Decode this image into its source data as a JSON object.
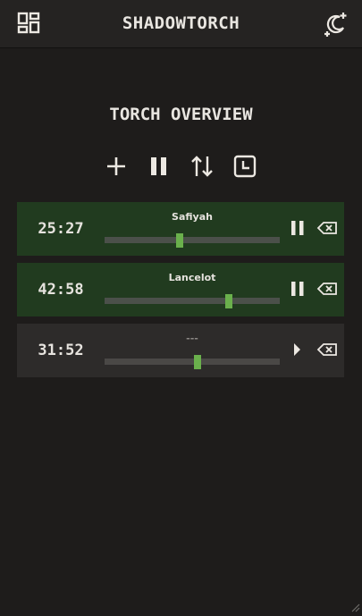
{
  "header": {
    "title": "SHADOWTORCH",
    "left_icon": "dashboard-icon",
    "right_icon": "theme-toggle-icon"
  },
  "main": {
    "title": "TORCH OVERVIEW",
    "toolbar": [
      {
        "icon": "plus-icon"
      },
      {
        "icon": "pause-all-icon"
      },
      {
        "icon": "sort-icon"
      },
      {
        "icon": "history-icon"
      }
    ]
  },
  "torches": [
    {
      "time": "25:27",
      "name": "Safiyah",
      "progress": 0.43,
      "state": "running",
      "control_icon": "pause-icon",
      "delete_icon": "backspace-icon"
    },
    {
      "time": "42:58",
      "name": "Lancelot",
      "progress": 0.71,
      "state": "running",
      "control_icon": "pause-icon",
      "delete_icon": "backspace-icon"
    },
    {
      "time": "31:52",
      "name": "---",
      "progress": 0.53,
      "state": "paused",
      "control_icon": "play-icon",
      "delete_icon": "backspace-icon"
    }
  ],
  "colors": {
    "background": "#1e1c1b",
    "header": "#252322",
    "card_active": "#213b1f",
    "card_paused": "#2d2b2a",
    "accent": "#6ab04c",
    "text": "#e9e6e1"
  }
}
